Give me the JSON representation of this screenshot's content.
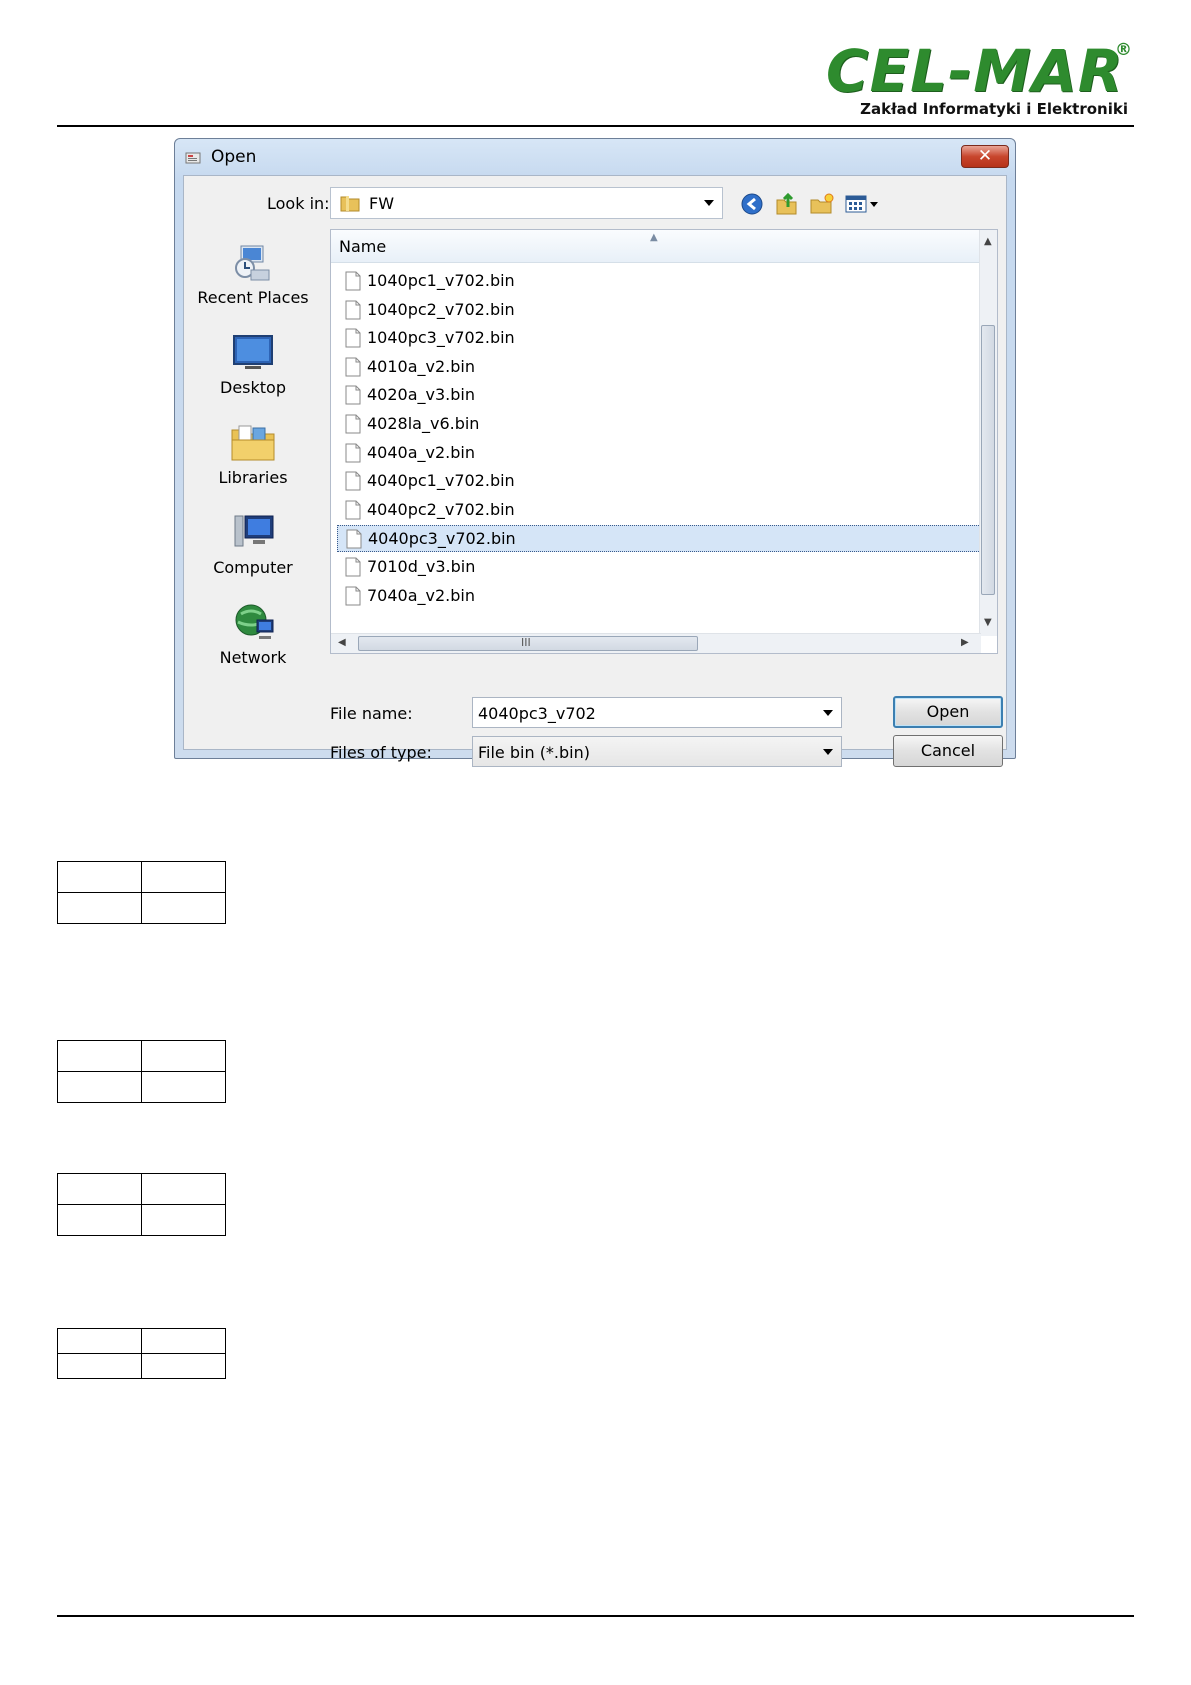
{
  "header": {
    "logo": "CEL-MAR",
    "registered": "®",
    "subtitle": "Zakład Informatyki i Elektroniki",
    "brand_color": "#2e8b2e"
  },
  "dialog": {
    "title": "Open",
    "close_label": "✕",
    "look_in_label": "Look in:",
    "look_in_value": "FW",
    "toolbar_icons": [
      "back-icon",
      "up-folder-icon",
      "new-folder-icon",
      "view-menu-icon"
    ],
    "places": [
      {
        "label": "Recent Places",
        "icon": "recent-places-icon"
      },
      {
        "label": "Desktop",
        "icon": "desktop-icon"
      },
      {
        "label": "Libraries",
        "icon": "libraries-icon"
      },
      {
        "label": "Computer",
        "icon": "computer-icon"
      },
      {
        "label": "Network",
        "icon": "network-icon"
      }
    ],
    "column_header": "Name",
    "files": [
      "1040pc1_v702.bin",
      "1040pc2_v702.bin",
      "1040pc3_v702.bin",
      "4010a_v2.bin",
      "4020a_v3.bin",
      "4028la_v6.bin",
      "4040a_v2.bin",
      "4040pc1_v702.bin",
      "4040pc2_v702.bin",
      "4040pc3_v702.bin",
      "7010d_v3.bin",
      "7040a_v2.bin"
    ],
    "selected_file": "4040pc3_v702.bin",
    "scroll_grip": "III",
    "file_name_label": "File name:",
    "file_name_value": "4040pc3_v702",
    "file_type_label": "Files of type:",
    "file_type_value": "File bin (*.bin)",
    "open_label": "Open",
    "cancel_label": "Cancel"
  },
  "tables": [
    {
      "rows": [
        [
          "",
          ""
        ],
        [
          "",
          ""
        ]
      ]
    },
    {
      "rows": [
        [
          "",
          ""
        ],
        [
          "",
          ""
        ]
      ]
    },
    {
      "rows": [
        [
          "",
          ""
        ],
        [
          "",
          ""
        ]
      ]
    },
    {
      "rows": [
        [
          "",
          ""
        ],
        [
          "",
          ""
        ]
      ]
    }
  ]
}
